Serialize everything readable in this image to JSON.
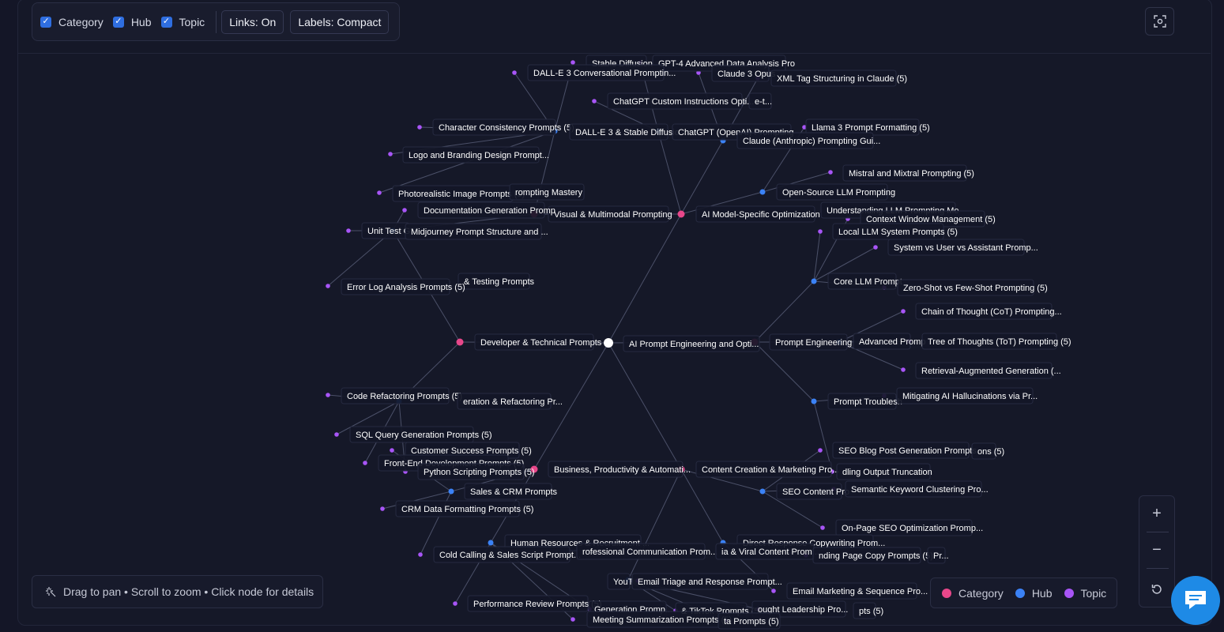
{
  "toolbar": {
    "filters": [
      {
        "label": "Category",
        "checked": true
      },
      {
        "label": "Hub",
        "checked": true
      },
      {
        "label": "Topic",
        "checked": true
      }
    ],
    "links_label": "Links: On",
    "labels_label": "Labels: Compact"
  },
  "fit_button_icon": "fit-view-icon",
  "help_text": "Drag to pan • Scroll to zoom • Click node for details",
  "legend": [
    {
      "label": "Category",
      "color": "#e8478a"
    },
    {
      "label": "Hub",
      "color": "#3b82f6"
    },
    {
      "label": "Topic",
      "color": "#a855f7"
    }
  ],
  "zoom": {
    "in_label": "+",
    "out_label": "−",
    "reset_icon": "reset-icon"
  },
  "chat_icon": "chat-bubble-icon",
  "colors": {
    "root": "#ffffff",
    "category": "#e8478a",
    "hub": "#3b82f6",
    "topic": "#a855f7",
    "link": "#4b5068"
  },
  "graph": {
    "labels": [
      {
        "text": "AI Prompt Engineering and Opti...",
        "count": ""
      },
      {
        "text": "Developer & Technical Prompts",
        "count": ""
      },
      {
        "text": "Visual & Multimodal Prompting",
        "count": ""
      },
      {
        "text": "AI Model-Specific Optimization",
        "count": ""
      },
      {
        "text": "Prompt Engineering",
        "count": ""
      },
      {
        "text": "Business, Productivity & Automati...",
        "count": ""
      },
      {
        "text": "Content Creation & Marketing Pro...",
        "count": ""
      },
      {
        "text": "Stable Diffusion",
        "count": ""
      },
      {
        "text": "GPT-4 Advanced Data Analysis Pro",
        "count": ""
      },
      {
        "text": "DALL-E 3 Conversational Promptin...",
        "count": ""
      },
      {
        "text": "Claude 3 Opus",
        "count": ""
      },
      {
        "text": "XML Tag Structuring in Claude",
        "count": "(5)"
      },
      {
        "text": "ChatGPT Custom Instructions Opti...",
        "count": ""
      },
      {
        "text": "e-t...",
        "count": ""
      },
      {
        "text": "Character Consistency Prompts",
        "count": "(5)"
      },
      {
        "text": "DALL-E 3 & Stable Diffusio",
        "count": ""
      },
      {
        "text": "ChatGPT (OpenAI) Prompting",
        "count": ""
      },
      {
        "text": "Llama 3 Prompt Formatting",
        "count": "(5)"
      },
      {
        "text": "Claude (Anthropic) Prompting Gui...",
        "count": ""
      },
      {
        "text": "Logo and Branding Design Prompt...",
        "count": ""
      },
      {
        "text": "Mistral and Mixtral Prompting",
        "count": "(5)"
      },
      {
        "text": "Photorealistic Image Prompts",
        "count": "(5)"
      },
      {
        "text": "rompting Mastery",
        "count": ""
      },
      {
        "text": "Open-Source LLM Prompting",
        "count": ""
      },
      {
        "text": "Documentation Generation Promp",
        "count": ""
      },
      {
        "text": "Understanding LLM Prompting Me",
        "count": ""
      },
      {
        "text": "Context Window Management",
        "count": "(5)"
      },
      {
        "text": "Unit Test G",
        "count": ""
      },
      {
        "text": "Midjourney Prompt Structure and ...",
        "count": ""
      },
      {
        "text": "Local LLM System Prompts",
        "count": "(5)"
      },
      {
        "text": "System vs User vs Assistant Promp...",
        "count": ""
      },
      {
        "text": "& Testing Prompts",
        "count": ""
      },
      {
        "text": "Core LLM Prompt",
        "count": ""
      },
      {
        "text": "Zero-Shot vs Few-Shot Prompting",
        "count": "(5)"
      },
      {
        "text": "Error Log Analysis Prompts",
        "count": "(5)"
      },
      {
        "text": "Chain of Thought (CoT) Prompting...",
        "count": ""
      },
      {
        "text": "Advanced Promp",
        "count": ""
      },
      {
        "text": "Tree of Thoughts (ToT) Prompting",
        "count": "(5)"
      },
      {
        "text": "Retrieval-Augmented Generation (...",
        "count": ""
      },
      {
        "text": "Code Refactoring Prompts",
        "count": "(5)"
      },
      {
        "text": "eration & Refactoring Pr...",
        "count": ""
      },
      {
        "text": "Prompt Troublesh",
        "count": ""
      },
      {
        "text": "Mitigating AI Hallucinations via Pr...",
        "count": ""
      },
      {
        "text": "SQL Query Generation Prompts",
        "count": "(5)"
      },
      {
        "text": "Customer Success Prompts",
        "count": "(5)"
      },
      {
        "text": "SEO Blog Post Generation Prompts...",
        "count": ""
      },
      {
        "text": "ons",
        "count": "(5)"
      },
      {
        "text": "Front-End Development Prompts",
        "count": "(5)"
      },
      {
        "text": "Python Scripting Prompts",
        "count": "(5)"
      },
      {
        "text": "dling Output Truncation",
        "count": ""
      },
      {
        "text": "Sales & CRM Prompts",
        "count": ""
      },
      {
        "text": "SEO Content Pro",
        "count": ""
      },
      {
        "text": "Semantic Keyword Clustering Pro...",
        "count": ""
      },
      {
        "text": "CRM Data Formatting Prompts",
        "count": "(5)"
      },
      {
        "text": "On-Page SEO Optimization Promp...",
        "count": ""
      },
      {
        "text": "Human Resources & Recruitment ...",
        "count": ""
      },
      {
        "text": "Direct Response Copywriting Prom...",
        "count": ""
      },
      {
        "text": "Cold Calling & Sales Script Prompt...",
        "count": ""
      },
      {
        "text": "rofessional Communication Prom...",
        "count": ""
      },
      {
        "text": "ia & Viral Content Prom...",
        "count": ""
      },
      {
        "text": "nding Page Copy Prompts",
        "count": "(5)"
      },
      {
        "text": "Pr...",
        "count": ""
      },
      {
        "text": "YouT",
        "count": ""
      },
      {
        "text": "Email Triage and Response Prompt...",
        "count": ""
      },
      {
        "text": "Email Marketing & Sequence Pro...",
        "count": ""
      },
      {
        "text": "Performance Review Prompts",
        "count": "(5)"
      },
      {
        "text": "Generation Promp...",
        "count": ""
      },
      {
        "text": "& TikTok Prompts",
        "count": "(5)"
      },
      {
        "text": "ought Leadership Pro...",
        "count": ""
      },
      {
        "text": "pts",
        "count": "(5)"
      },
      {
        "text": "Meeting Summarization Prompts",
        "count": "(5)"
      },
      {
        "text": "ta Prompts",
        "count": "(5)"
      }
    ]
  }
}
